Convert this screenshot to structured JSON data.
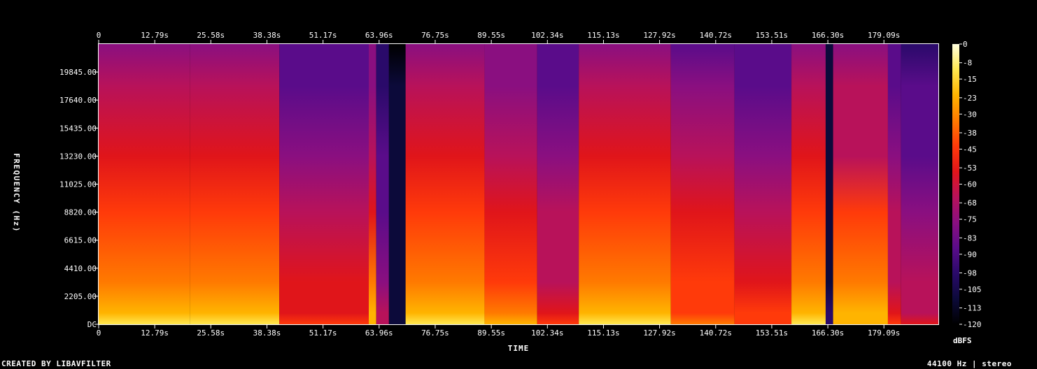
{
  "chart_data": {
    "type": "heatmap",
    "title": "",
    "xlabel": "TIME",
    "ylabel": "FREQUENCY (Hz)",
    "colorbar_label": "dBFS",
    "x_ticks": [
      "0",
      "12.79s",
      "25.58s",
      "38.38s",
      "51.17s",
      "63.96s",
      "76.75s",
      "89.55s",
      "102.34s",
      "115.13s",
      "127.92s",
      "140.72s",
      "153.51s",
      "166.30s",
      "179.09s"
    ],
    "x_tick_values": [
      0,
      12.79,
      25.58,
      38.38,
      51.17,
      63.96,
      76.75,
      89.55,
      102.34,
      115.13,
      127.92,
      140.72,
      153.51,
      166.3,
      179.09
    ],
    "xlim": [
      0,
      191.5
    ],
    "y_ticks": [
      "DC",
      "2205.00",
      "4410.00",
      "6615.00",
      "8820.00",
      "11025.00",
      "13230.00",
      "15435.00",
      "17640.00",
      "19845.00"
    ],
    "y_tick_values": [
      0,
      2205,
      4410,
      6615,
      8820,
      11025,
      13230,
      15435,
      17640,
      19845
    ],
    "ylim": [
      0,
      22050
    ],
    "colorbar_ticks": [
      "0",
      "-8",
      "-15",
      "-23",
      "-30",
      "-38",
      "-45",
      "-53",
      "-60",
      "-68",
      "-75",
      "-83",
      "-90",
      "-98",
      "-105",
      "-113",
      "-120"
    ],
    "colorbar_range": [
      -120,
      0
    ],
    "colormap": [
      "#000000",
      "#0c0a3a",
      "#2a0a6a",
      "#5a0c8a",
      "#8a0f80",
      "#b8125a",
      "#e0151a",
      "#ff3a0a",
      "#ff7a00",
      "#ffb400",
      "#ffe850",
      "#ffffe0"
    ],
    "segments": [
      {
        "start": 0.0,
        "end": 20.8,
        "level": 0.9
      },
      {
        "start": 20.8,
        "end": 41.2,
        "level": 0.88
      },
      {
        "start": 41.2,
        "end": 61.6,
        "level": 0.62
      },
      {
        "start": 61.6,
        "end": 63.3,
        "level": 0.84
      },
      {
        "start": 63.3,
        "end": 66.2,
        "level": 0.45
      },
      {
        "start": 66.2,
        "end": 70.0,
        "level": 0.1
      },
      {
        "start": 70.0,
        "end": 88.0,
        "level": 0.92
      },
      {
        "start": 88.0,
        "end": 100.0,
        "level": 0.8
      },
      {
        "start": 100.0,
        "end": 109.5,
        "level": 0.6
      },
      {
        "start": 109.5,
        "end": 130.5,
        "level": 0.91
      },
      {
        "start": 130.5,
        "end": 145.0,
        "level": 0.73
      },
      {
        "start": 145.0,
        "end": 158.0,
        "level": 0.66
      },
      {
        "start": 158.0,
        "end": 165.8,
        "level": 0.89
      },
      {
        "start": 165.8,
        "end": 167.5,
        "level": 0.15
      },
      {
        "start": 167.5,
        "end": 180.0,
        "level": 0.86
      },
      {
        "start": 180.0,
        "end": 183.0,
        "level": 0.6
      },
      {
        "start": 183.0,
        "end": 191.5,
        "level": 0.5
      }
    ]
  },
  "footer": {
    "left": "CREATED BY LIBAVFILTER",
    "right": "44100 Hz | stereo"
  }
}
